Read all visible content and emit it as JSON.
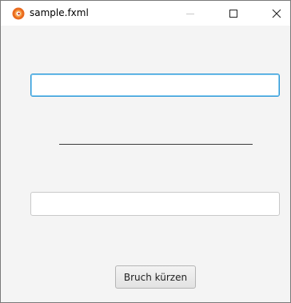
{
  "window": {
    "title": "sample.fxml",
    "app_icon": "java-duke-icon",
    "controls": {
      "minimize_icon": "minimize-icon",
      "maximize_icon": "maximize-icon",
      "close_icon": "close-icon"
    }
  },
  "form": {
    "numerator_value": "",
    "denominator_value": "",
    "reduce_button_label": "Bruch kürzen"
  },
  "colors": {
    "focus_border": "#2a96d6",
    "fraction_line": "#3a3a3a",
    "app_icon_orange": "#ea6b1f"
  }
}
